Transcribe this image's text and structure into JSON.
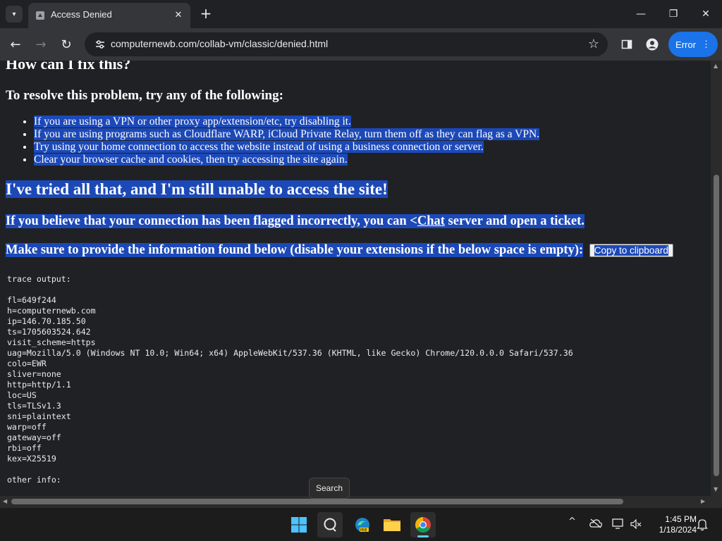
{
  "browser": {
    "tab": {
      "title": "Access Denied"
    },
    "new_tab_label": "+",
    "url": "computernewb.com/collab-vm/classic/denied.html",
    "error_label": "Error",
    "error_menu_glyph": "⋮",
    "window_controls": {
      "minimize": "—",
      "maximize": "❐",
      "close": "✕"
    },
    "tab_close": "✕",
    "tab_search_glyph": "▾",
    "nav": {
      "back": "←",
      "forward": "→",
      "reload": "↻"
    },
    "star": "☆"
  },
  "page": {
    "heading_fix": "How can I fix this?",
    "heading_resolve": "To resolve this problem, try any of the following:",
    "fix_items": [
      "If you are using a VPN or other proxy app/extension/etc, try disabling it.",
      "If you are using programs such as Cloudflare WARP, iCloud Private Relay, turn them off as they can flag as a VPN.",
      "Try using your home connection to access the website instead of using a business connection or server.",
      "Clear your browser cache and cookies, then try accessing the site again."
    ],
    "heading_tried": "I've tried all that, and I'm still unable to access the site!",
    "believe_prefix": "If you believe that your connection has been flagged incorrectly, you can <",
    "believe_link": "Chat",
    "believe_suffix": " server and open a ticket.",
    "provide_text": "Make sure to provide the information found below (disable your extensions if the below space is empty):",
    "copy_button": "Copy to clipboard",
    "trace_header": "trace output:",
    "trace_lines": [
      "fl=649f244",
      "h=computernewb.com",
      "ip=146.70.185.50",
      "ts=1705603524.642",
      "visit_scheme=https",
      "uag=Mozilla/5.0 (Windows NT 10.0; Win64; x64) AppleWebKit/537.36 (KHTML, like Gecko) Chrome/120.0.0.0 Safari/537.36",
      "colo=EWR",
      "sliver=none",
      "http=http/1.1",
      "loc=US",
      "tls=TLSv1.3",
      "sni=plaintext",
      "warp=off",
      "gateway=off",
      "rbi=off",
      "kex=X25519"
    ],
    "other_info": "other info:"
  },
  "tooltip": "Search",
  "taskbar": {
    "apps": [
      {
        "name": "start-button",
        "icon": "windows-logo-icon"
      },
      {
        "name": "search-button",
        "icon": "search-icon"
      },
      {
        "name": "edge-preview-button",
        "icon": "edge-icon"
      },
      {
        "name": "file-explorer-button",
        "icon": "folder-icon"
      },
      {
        "name": "chrome-button",
        "icon": "chrome-icon",
        "active": true
      }
    ],
    "tray_chevron": "^",
    "time": "1:45 PM",
    "date": "1/18/2024"
  },
  "colors": {
    "selection": "#1c49b8",
    "accent_button": "#1a73e8",
    "page_bg": "#202124"
  }
}
